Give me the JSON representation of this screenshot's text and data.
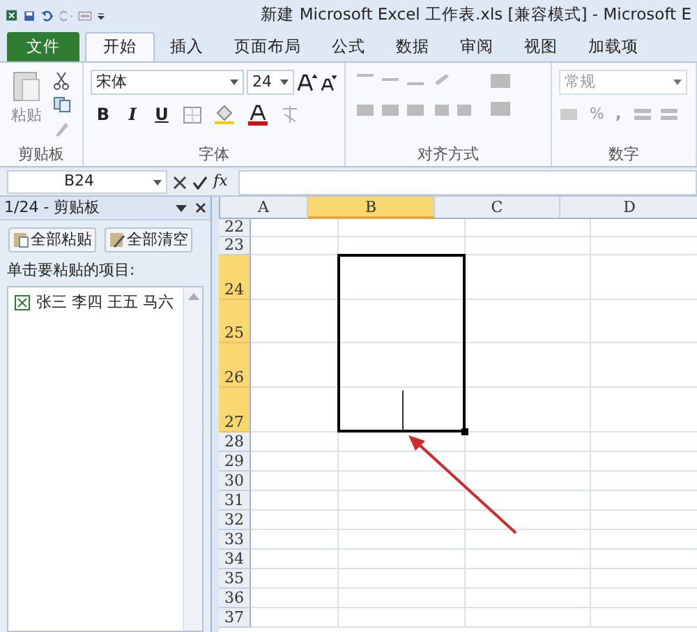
{
  "window": {
    "title": "新建 Microsoft Excel 工作表.xls  [兼容模式] - Microsoft E"
  },
  "file_tab": "文件",
  "tabs": [
    {
      "label": "开始",
      "selected": true
    },
    {
      "label": "插入",
      "selected": false
    },
    {
      "label": "页面布局",
      "selected": false
    },
    {
      "label": "公式",
      "selected": false
    },
    {
      "label": "数据",
      "selected": false
    },
    {
      "label": "审阅",
      "selected": false
    },
    {
      "label": "视图",
      "selected": false
    },
    {
      "label": "加载项",
      "selected": false
    }
  ],
  "ribbon": {
    "paste_label": "粘贴",
    "font_name": "宋体",
    "font_size": "24",
    "number_format": "常规",
    "bold": "B",
    "italic": "I",
    "underline": "U",
    "percent": "%",
    "comma": ",",
    "groups": [
      "剪贴板",
      "字体",
      "对齐方式",
      "数字"
    ]
  },
  "formula_bar": {
    "name_box": "B24",
    "function_label": "fx"
  },
  "clipboard_pane": {
    "title": "1/24 - 剪贴板",
    "buttons": [
      "全部粘贴",
      "全部清空"
    ],
    "instruction": "单击要粘贴的项目:",
    "items": [
      "张三 李四 王五 马六"
    ]
  },
  "sheet": {
    "columns": [
      {
        "label": "A",
        "selected": false
      },
      {
        "label": "B",
        "selected": true
      },
      {
        "label": "C",
        "selected": false
      },
      {
        "label": "D",
        "selected": false
      }
    ],
    "rows": [
      {
        "label": "22",
        "selected": false
      },
      {
        "label": "23",
        "selected": false
      },
      {
        "label": "24",
        "selected": true
      },
      {
        "label": "25",
        "selected": true
      },
      {
        "label": "26",
        "selected": true
      },
      {
        "label": "27",
        "selected": true
      },
      {
        "label": "28",
        "selected": false
      },
      {
        "label": "29",
        "selected": false
      },
      {
        "label": "30",
        "selected": false
      },
      {
        "label": "31",
        "selected": false
      },
      {
        "label": "32",
        "selected": false
      },
      {
        "label": "33",
        "selected": false
      },
      {
        "label": "34",
        "selected": false
      },
      {
        "label": "35",
        "selected": false
      },
      {
        "label": "36",
        "selected": false
      },
      {
        "label": "37",
        "selected": false
      }
    ]
  }
}
